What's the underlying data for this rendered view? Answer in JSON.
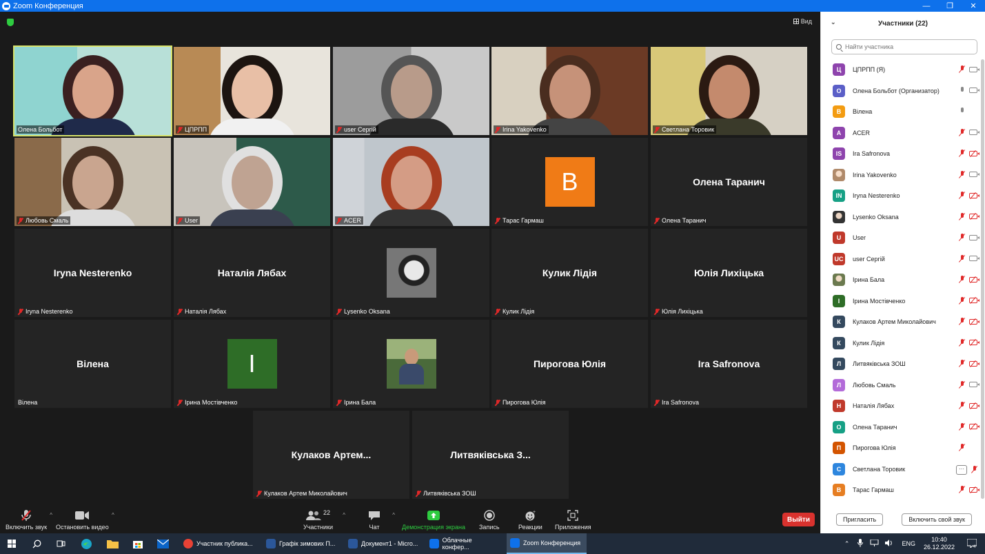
{
  "window": {
    "title": "Zoom Конференция",
    "min": "—",
    "max": "❐",
    "close": "✕"
  },
  "header": {
    "view_label": "Вид"
  },
  "tiles": [
    {
      "name": "Олена Больбот",
      "muted": false,
      "kind": "video"
    },
    {
      "name": "ЦПРПП",
      "muted": true,
      "kind": "video"
    },
    {
      "name": "user Сергій",
      "muted": true,
      "kind": "video"
    },
    {
      "name": "Irina Yakovenko",
      "muted": true,
      "kind": "video"
    },
    {
      "name": "Светлана Торовик",
      "muted": true,
      "kind": "video"
    },
    {
      "name": "Любовь Смаль",
      "muted": true,
      "kind": "video"
    },
    {
      "name": "User",
      "muted": true,
      "kind": "video"
    },
    {
      "name": "ACER",
      "muted": true,
      "kind": "video"
    },
    {
      "name": "Тарас Гармаш",
      "muted": true,
      "kind": "avatar",
      "letter": "B",
      "color": "#f07b16"
    },
    {
      "name": "Олена Таранич",
      "muted": true,
      "kind": "text",
      "display": "Олена Таранич"
    },
    {
      "name": "Iryna Nesterenko",
      "muted": true,
      "kind": "text",
      "display": "Iryna Nesterenko"
    },
    {
      "name": "Наталія Лябах",
      "muted": true,
      "kind": "text",
      "display": "Наталія Лябах"
    },
    {
      "name": "Lysenko Oksana",
      "muted": true,
      "kind": "photo"
    },
    {
      "name": "Кулик Лідія",
      "muted": true,
      "kind": "text",
      "display": "Кулик Лідія"
    },
    {
      "name": "Юлія Лихіцька",
      "muted": true,
      "kind": "text",
      "display": "Юлія Лихіцька"
    },
    {
      "name": "Вілена",
      "muted": false,
      "kind": "text",
      "display": "Вілена"
    },
    {
      "name": "Ірина Мостівченко",
      "muted": true,
      "kind": "avatar",
      "letter": "I",
      "color": "#2e6d27"
    },
    {
      "name": "Ірина Бала",
      "muted": true,
      "kind": "photo"
    },
    {
      "name": "Пирогова Юлія",
      "muted": true,
      "kind": "text",
      "display": "Пирогова Юлія"
    },
    {
      "name": "Ira Safronova",
      "muted": true,
      "kind": "text",
      "display": "Ira Safronova"
    },
    {
      "name": "Кулаков Артем Миколайович",
      "muted": true,
      "kind": "text",
      "display": "Кулаков  Артем..."
    },
    {
      "name": "Литвяківська ЗОШ",
      "muted": true,
      "kind": "text",
      "display": "Литвяківська З..."
    }
  ],
  "toolbar": {
    "audio": "Включить звук",
    "video": "Остановить видео",
    "participants": "Участники",
    "participants_count": "22",
    "chat": "Чат",
    "share": "Демонстрация экрана",
    "record": "Запись",
    "reactions": "Реакции",
    "apps": "Приложения",
    "end": "Выйти",
    "share_color": "#2ecc40",
    "end_color": "#d9322e"
  },
  "panel": {
    "title": "Участники (22)",
    "search_placeholder": "Найти участника",
    "invite": "Пригласить",
    "unmute_self": "Включить свой звук",
    "participants": [
      {
        "initials": "Ц",
        "color": "#8e44ad",
        "name": "ЦПРПП (Я)",
        "mic": "off",
        "cam": "on"
      },
      {
        "initials": "О",
        "color": "#5b5fc7",
        "name": "Олена Больбот (Организатор)",
        "mic": "on",
        "cam": "on"
      },
      {
        "initials": "В",
        "color": "#f39c12",
        "name": "Вілена",
        "mic": "on",
        "cam": "none"
      },
      {
        "initials": "A",
        "color": "#8e44ad",
        "name": "ACER",
        "mic": "off",
        "cam": "on"
      },
      {
        "initials": "IS",
        "color": "#8e44ad",
        "name": "Ira Safronova",
        "mic": "off",
        "cam": "off"
      },
      {
        "initials": "",
        "color": "#b08a6a",
        "name": "Irina Yakovenko",
        "mic": "off",
        "cam": "on"
      },
      {
        "initials": "IN",
        "color": "#16a085",
        "name": "Iryna Nesterenko",
        "mic": "off",
        "cam": "off"
      },
      {
        "initials": "",
        "color": "#333333",
        "name": "Lysenko Oksana",
        "mic": "off",
        "cam": "off"
      },
      {
        "initials": "U",
        "color": "#c0392b",
        "name": "User",
        "mic": "off",
        "cam": "on"
      },
      {
        "initials": "UC",
        "color": "#c0392b",
        "name": "user Сергій",
        "mic": "off",
        "cam": "on"
      },
      {
        "initials": "",
        "color": "#6b7a4f",
        "name": "Ірина Бала",
        "mic": "off",
        "cam": "off"
      },
      {
        "initials": "І",
        "color": "#2e6d27",
        "name": "Ірина Мостівченко",
        "mic": "off",
        "cam": "off"
      },
      {
        "initials": "К",
        "color": "#34495e",
        "name": "Кулаков Артем Миколайович",
        "mic": "off",
        "cam": "off"
      },
      {
        "initials": "К",
        "color": "#34495e",
        "name": "Кулик Лідія",
        "mic": "off",
        "cam": "off"
      },
      {
        "initials": "Л",
        "color": "#34495e",
        "name": "Литвяківська ЗОШ",
        "mic": "off",
        "cam": "off"
      },
      {
        "initials": "Л",
        "color": "#b36bd9",
        "name": "Любовь Смаль",
        "mic": "off",
        "cam": "on"
      },
      {
        "initials": "Н",
        "color": "#c0392b",
        "name": "Наталія Лябах",
        "mic": "off",
        "cam": "off"
      },
      {
        "initials": "О",
        "color": "#16a085",
        "name": "Олена Таранич",
        "mic": "off",
        "cam": "off"
      },
      {
        "initials": "П",
        "color": "#d35400",
        "name": "Пирогова Юлія",
        "mic": "off",
        "cam": "none"
      },
      {
        "initials": "С",
        "color": "#2e86de",
        "name": "Светлана Торовик",
        "mic": "off",
        "cam": "more"
      },
      {
        "initials": "В",
        "color": "#e67e22",
        "name": "Тарас Гармаш",
        "mic": "off",
        "cam": "off"
      }
    ]
  },
  "taskbar": {
    "tasks": [
      {
        "label": "Участник публика...",
        "color": "#e94235",
        "active": false
      },
      {
        "label": "Графік зимових П...",
        "color": "#2b579a",
        "active": false
      },
      {
        "label": "Документ1 - Micro...",
        "color": "#2b579a",
        "active": false
      },
      {
        "label": "Облачные конфер...",
        "color": "#0e71eb",
        "active": false
      },
      {
        "label": "Zoom Конференция",
        "color": "#0e71eb",
        "active": true
      }
    ],
    "lang": "ENG",
    "time": "10:40",
    "date": "26.12.2022"
  }
}
